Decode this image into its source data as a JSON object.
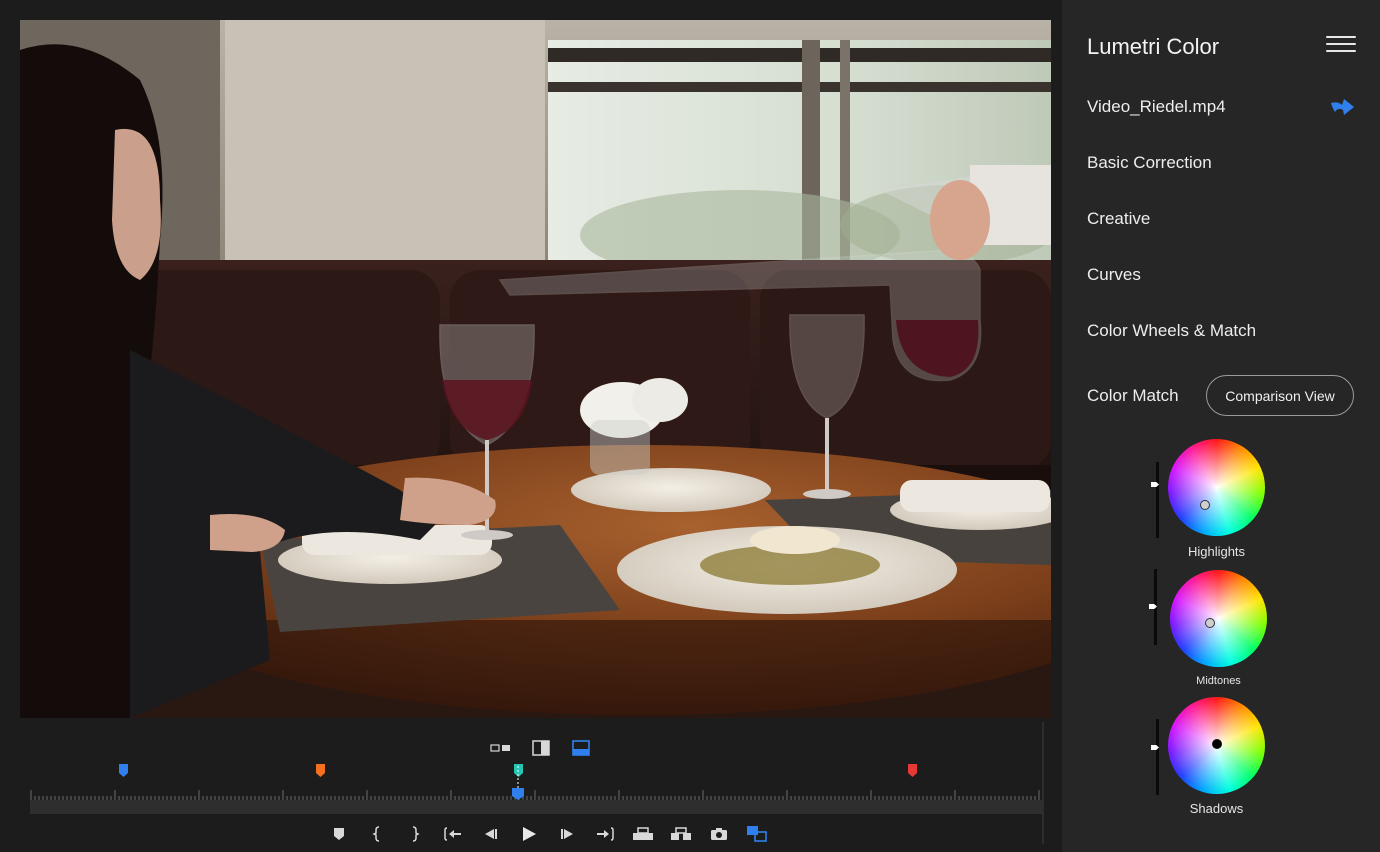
{
  "panel": {
    "title": "Lumetri Color",
    "file_name": "Video_Riedel.mp4",
    "sections": [
      "Basic Correction",
      "Creative",
      "Curves",
      "Color Wheels & Match"
    ],
    "color_match_label": "Color Match",
    "comparison_button": "Comparison View",
    "wheels": [
      {
        "label": "Highlights"
      },
      {
        "label": "Midtones"
      },
      {
        "label": "Shadows"
      }
    ]
  },
  "timeline": {
    "marker_colors": [
      "#2f80ed",
      "#f2701f",
      "#26c6b7",
      "#e53935"
    ],
    "playhead_color": "#2f80ed",
    "active_view_mode": "timeline"
  },
  "colors": {
    "accent": "#2f80ed",
    "panel_bg": "#262626",
    "app_bg": "#1c1c1c"
  },
  "icons": {
    "menu": "hamburger-menu-icon",
    "share": "forward-arrow-icon",
    "transport": [
      "add-marker-icon",
      "mark-in-icon",
      "mark-out-icon",
      "go-to-in-icon",
      "step-back-icon",
      "play-icon",
      "step-forward-icon",
      "go-to-out-icon",
      "lift-icon",
      "extract-icon",
      "export-frame-icon",
      "comparison-view-icon"
    ]
  }
}
